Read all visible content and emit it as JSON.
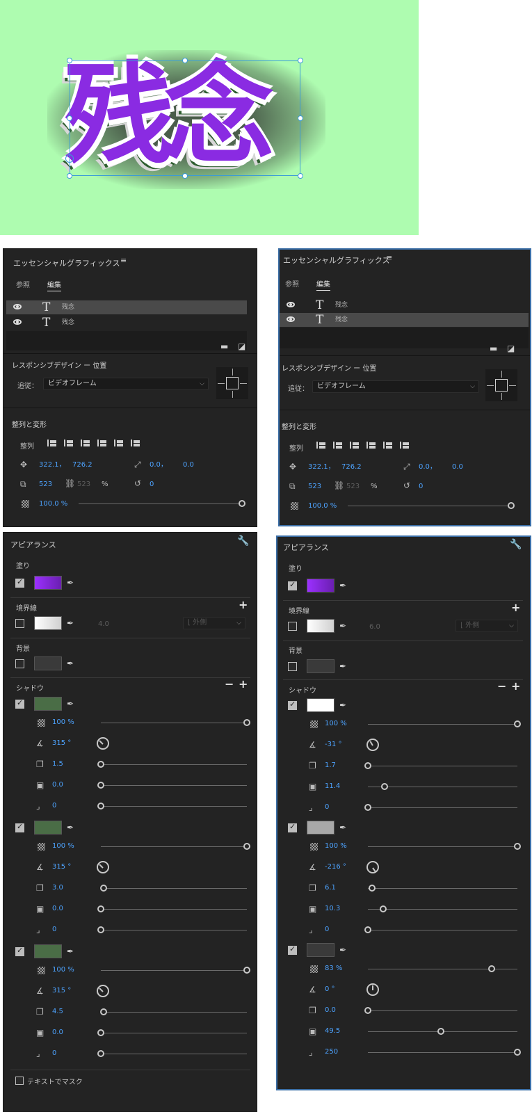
{
  "preview": {
    "title_text": "残念"
  },
  "left_panel": {
    "header": "エッセンシャルグラフィックス",
    "menu_icon": "hamburger-icon",
    "tabs": [
      "参照",
      "編集"
    ],
    "layers": [
      {
        "name": "残念"
      },
      {
        "name": "残念"
      }
    ],
    "responsive_title": "レスポンシブデザイン ー 位置",
    "follow_label": "追従：",
    "follow_value": "ビデオフレーム",
    "align_title": "整列と変形",
    "align_label": "整列",
    "pos_x": "322.1，",
    "pos_y": "726.2",
    "anchor_x": "0.0，",
    "anchor_y": "0.0",
    "scale": "523",
    "scale_h": "523",
    "scale_unit": "%",
    "rotation": "0",
    "opacity": "100.0 %"
  },
  "right_panel": {
    "header": "エッセンシャルグラフィックス",
    "tabs": [
      "参照",
      "編集"
    ],
    "layers": [
      {
        "name": "残念"
      },
      {
        "name": "残念"
      }
    ],
    "responsive_title": "レスポンシブデザイン ー 位置",
    "follow_label": "追従：",
    "follow_value": "ビデオフレーム",
    "align_title": "整列と変形",
    "align_label": "整列",
    "pos_x": "322.1，",
    "pos_y": "726.2",
    "anchor_x": "0.0，",
    "anchor_y": "0.0",
    "scale": "523",
    "scale_h": "523",
    "scale_unit": "%",
    "rotation": "0",
    "opacity": "100.0 %"
  },
  "left_appearance": {
    "title": "アピアランス",
    "fill_label": "塗り",
    "stroke_label": "境界線",
    "stroke_width": "4.0",
    "stroke_type": "外側",
    "bg_label": "背景",
    "shadow_label": "シャドウ",
    "shadows": [
      {
        "color": "#4a6d46",
        "opacity": "100 %",
        "opacity_level": 1.0,
        "angle": "315 °",
        "angle_deg": 315,
        "distance": "1.5",
        "distance_level": 0.0,
        "size": "0.0",
        "size_level": 0.0,
        "blur": "0",
        "blur_level": 0.0
      },
      {
        "color": "#4a6d46",
        "opacity": "100 %",
        "opacity_level": 1.0,
        "angle": "315 °",
        "angle_deg": 315,
        "distance": "3.0",
        "distance_level": 0.02,
        "size": "0.0",
        "size_level": 0.0,
        "blur": "0",
        "blur_level": 0.0
      },
      {
        "color": "#4a6d46",
        "opacity": "100 %",
        "opacity_level": 1.0,
        "angle": "315 °",
        "angle_deg": 315,
        "distance": "4.5",
        "distance_level": 0.02,
        "size": "0.0",
        "size_level": 0.0,
        "blur": "0",
        "blur_level": 0.0
      }
    ],
    "mask_label": "テキストでマスク"
  },
  "right_appearance": {
    "title": "アピアランス",
    "fill_label": "塗り",
    "stroke_label": "境界線",
    "stroke_width": "6.0",
    "stroke_type": "外側",
    "bg_label": "背景",
    "shadow_label": "シャドウ",
    "shadows": [
      {
        "color": "#ffffff",
        "opacity": "100 %",
        "opacity_level": 1.0,
        "angle": "-31 °",
        "angle_deg": -31,
        "distance": "1.7",
        "distance_level": 0.0,
        "size": "11.4",
        "size_level": 0.11,
        "blur": "0",
        "blur_level": 0.0
      },
      {
        "color": "#a8a8a8",
        "opacity": "100 %",
        "opacity_level": 1.0,
        "angle": "-216 °",
        "angle_deg": -216,
        "distance": "6.1",
        "distance_level": 0.03,
        "size": "10.3",
        "size_level": 0.1,
        "blur": "0",
        "blur_level": 0.0
      },
      {
        "color": "#3a3a3a",
        "opacity": "83 %",
        "opacity_level": 0.83,
        "angle": "0 °",
        "angle_deg": 0,
        "distance": "0.0",
        "distance_level": 0.0,
        "size": "49.5",
        "size_level": 0.49,
        "blur": "250",
        "blur_level": 1.0
      }
    ]
  }
}
